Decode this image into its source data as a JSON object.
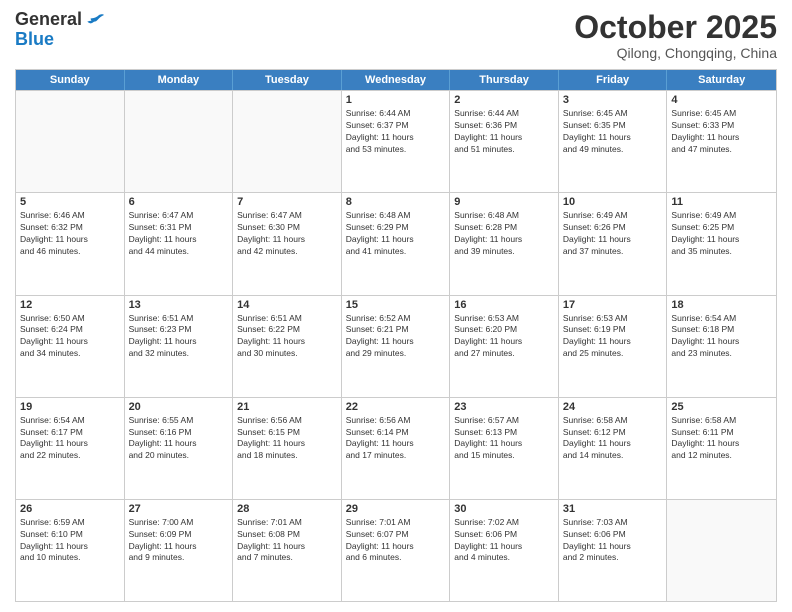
{
  "header": {
    "logo_general": "General",
    "logo_blue": "Blue",
    "month": "October 2025",
    "location": "Qilong, Chongqing, China"
  },
  "days_of_week": [
    "Sunday",
    "Monday",
    "Tuesday",
    "Wednesday",
    "Thursday",
    "Friday",
    "Saturday"
  ],
  "weeks": [
    [
      {
        "day": "",
        "info": ""
      },
      {
        "day": "",
        "info": ""
      },
      {
        "day": "",
        "info": ""
      },
      {
        "day": "1",
        "info": "Sunrise: 6:44 AM\nSunset: 6:37 PM\nDaylight: 11 hours\nand 53 minutes."
      },
      {
        "day": "2",
        "info": "Sunrise: 6:44 AM\nSunset: 6:36 PM\nDaylight: 11 hours\nand 51 minutes."
      },
      {
        "day": "3",
        "info": "Sunrise: 6:45 AM\nSunset: 6:35 PM\nDaylight: 11 hours\nand 49 minutes."
      },
      {
        "day": "4",
        "info": "Sunrise: 6:45 AM\nSunset: 6:33 PM\nDaylight: 11 hours\nand 47 minutes."
      }
    ],
    [
      {
        "day": "5",
        "info": "Sunrise: 6:46 AM\nSunset: 6:32 PM\nDaylight: 11 hours\nand 46 minutes."
      },
      {
        "day": "6",
        "info": "Sunrise: 6:47 AM\nSunset: 6:31 PM\nDaylight: 11 hours\nand 44 minutes."
      },
      {
        "day": "7",
        "info": "Sunrise: 6:47 AM\nSunset: 6:30 PM\nDaylight: 11 hours\nand 42 minutes."
      },
      {
        "day": "8",
        "info": "Sunrise: 6:48 AM\nSunset: 6:29 PM\nDaylight: 11 hours\nand 41 minutes."
      },
      {
        "day": "9",
        "info": "Sunrise: 6:48 AM\nSunset: 6:28 PM\nDaylight: 11 hours\nand 39 minutes."
      },
      {
        "day": "10",
        "info": "Sunrise: 6:49 AM\nSunset: 6:26 PM\nDaylight: 11 hours\nand 37 minutes."
      },
      {
        "day": "11",
        "info": "Sunrise: 6:49 AM\nSunset: 6:25 PM\nDaylight: 11 hours\nand 35 minutes."
      }
    ],
    [
      {
        "day": "12",
        "info": "Sunrise: 6:50 AM\nSunset: 6:24 PM\nDaylight: 11 hours\nand 34 minutes."
      },
      {
        "day": "13",
        "info": "Sunrise: 6:51 AM\nSunset: 6:23 PM\nDaylight: 11 hours\nand 32 minutes."
      },
      {
        "day": "14",
        "info": "Sunrise: 6:51 AM\nSunset: 6:22 PM\nDaylight: 11 hours\nand 30 minutes."
      },
      {
        "day": "15",
        "info": "Sunrise: 6:52 AM\nSunset: 6:21 PM\nDaylight: 11 hours\nand 29 minutes."
      },
      {
        "day": "16",
        "info": "Sunrise: 6:53 AM\nSunset: 6:20 PM\nDaylight: 11 hours\nand 27 minutes."
      },
      {
        "day": "17",
        "info": "Sunrise: 6:53 AM\nSunset: 6:19 PM\nDaylight: 11 hours\nand 25 minutes."
      },
      {
        "day": "18",
        "info": "Sunrise: 6:54 AM\nSunset: 6:18 PM\nDaylight: 11 hours\nand 23 minutes."
      }
    ],
    [
      {
        "day": "19",
        "info": "Sunrise: 6:54 AM\nSunset: 6:17 PM\nDaylight: 11 hours\nand 22 minutes."
      },
      {
        "day": "20",
        "info": "Sunrise: 6:55 AM\nSunset: 6:16 PM\nDaylight: 11 hours\nand 20 minutes."
      },
      {
        "day": "21",
        "info": "Sunrise: 6:56 AM\nSunset: 6:15 PM\nDaylight: 11 hours\nand 18 minutes."
      },
      {
        "day": "22",
        "info": "Sunrise: 6:56 AM\nSunset: 6:14 PM\nDaylight: 11 hours\nand 17 minutes."
      },
      {
        "day": "23",
        "info": "Sunrise: 6:57 AM\nSunset: 6:13 PM\nDaylight: 11 hours\nand 15 minutes."
      },
      {
        "day": "24",
        "info": "Sunrise: 6:58 AM\nSunset: 6:12 PM\nDaylight: 11 hours\nand 14 minutes."
      },
      {
        "day": "25",
        "info": "Sunrise: 6:58 AM\nSunset: 6:11 PM\nDaylight: 11 hours\nand 12 minutes."
      }
    ],
    [
      {
        "day": "26",
        "info": "Sunrise: 6:59 AM\nSunset: 6:10 PM\nDaylight: 11 hours\nand 10 minutes."
      },
      {
        "day": "27",
        "info": "Sunrise: 7:00 AM\nSunset: 6:09 PM\nDaylight: 11 hours\nand 9 minutes."
      },
      {
        "day": "28",
        "info": "Sunrise: 7:01 AM\nSunset: 6:08 PM\nDaylight: 11 hours\nand 7 minutes."
      },
      {
        "day": "29",
        "info": "Sunrise: 7:01 AM\nSunset: 6:07 PM\nDaylight: 11 hours\nand 6 minutes."
      },
      {
        "day": "30",
        "info": "Sunrise: 7:02 AM\nSunset: 6:06 PM\nDaylight: 11 hours\nand 4 minutes."
      },
      {
        "day": "31",
        "info": "Sunrise: 7:03 AM\nSunset: 6:06 PM\nDaylight: 11 hours\nand 2 minutes."
      },
      {
        "day": "",
        "info": ""
      }
    ]
  ]
}
